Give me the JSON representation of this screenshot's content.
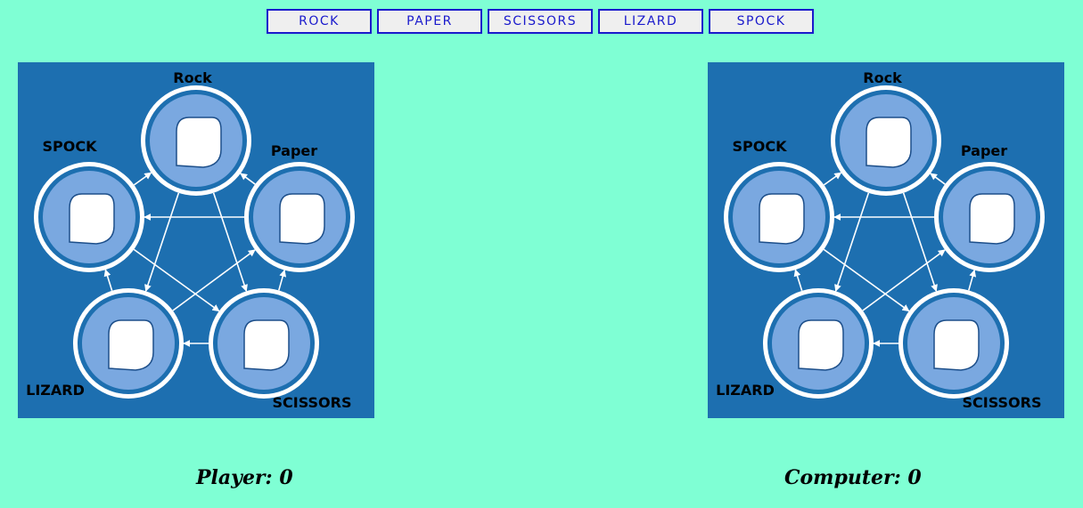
{
  "choices": [
    "ROCK",
    "PAPER",
    "SCISSORS",
    "LIZARD",
    "SPOCK"
  ],
  "diagram_labels": {
    "rock": "Rock",
    "paper": "Paper",
    "scissors": "SCISSORS",
    "lizard": "LIZARD",
    "spock": "SPOCK"
  },
  "score": {
    "player_label": "Player",
    "player_value": "0",
    "computer_label": "Computer",
    "computer_value": "0"
  },
  "colors": {
    "background": "#7fffd4",
    "board": "#1d6fb0",
    "circle": "#7aa8e0",
    "button_border": "#1a1acc"
  }
}
